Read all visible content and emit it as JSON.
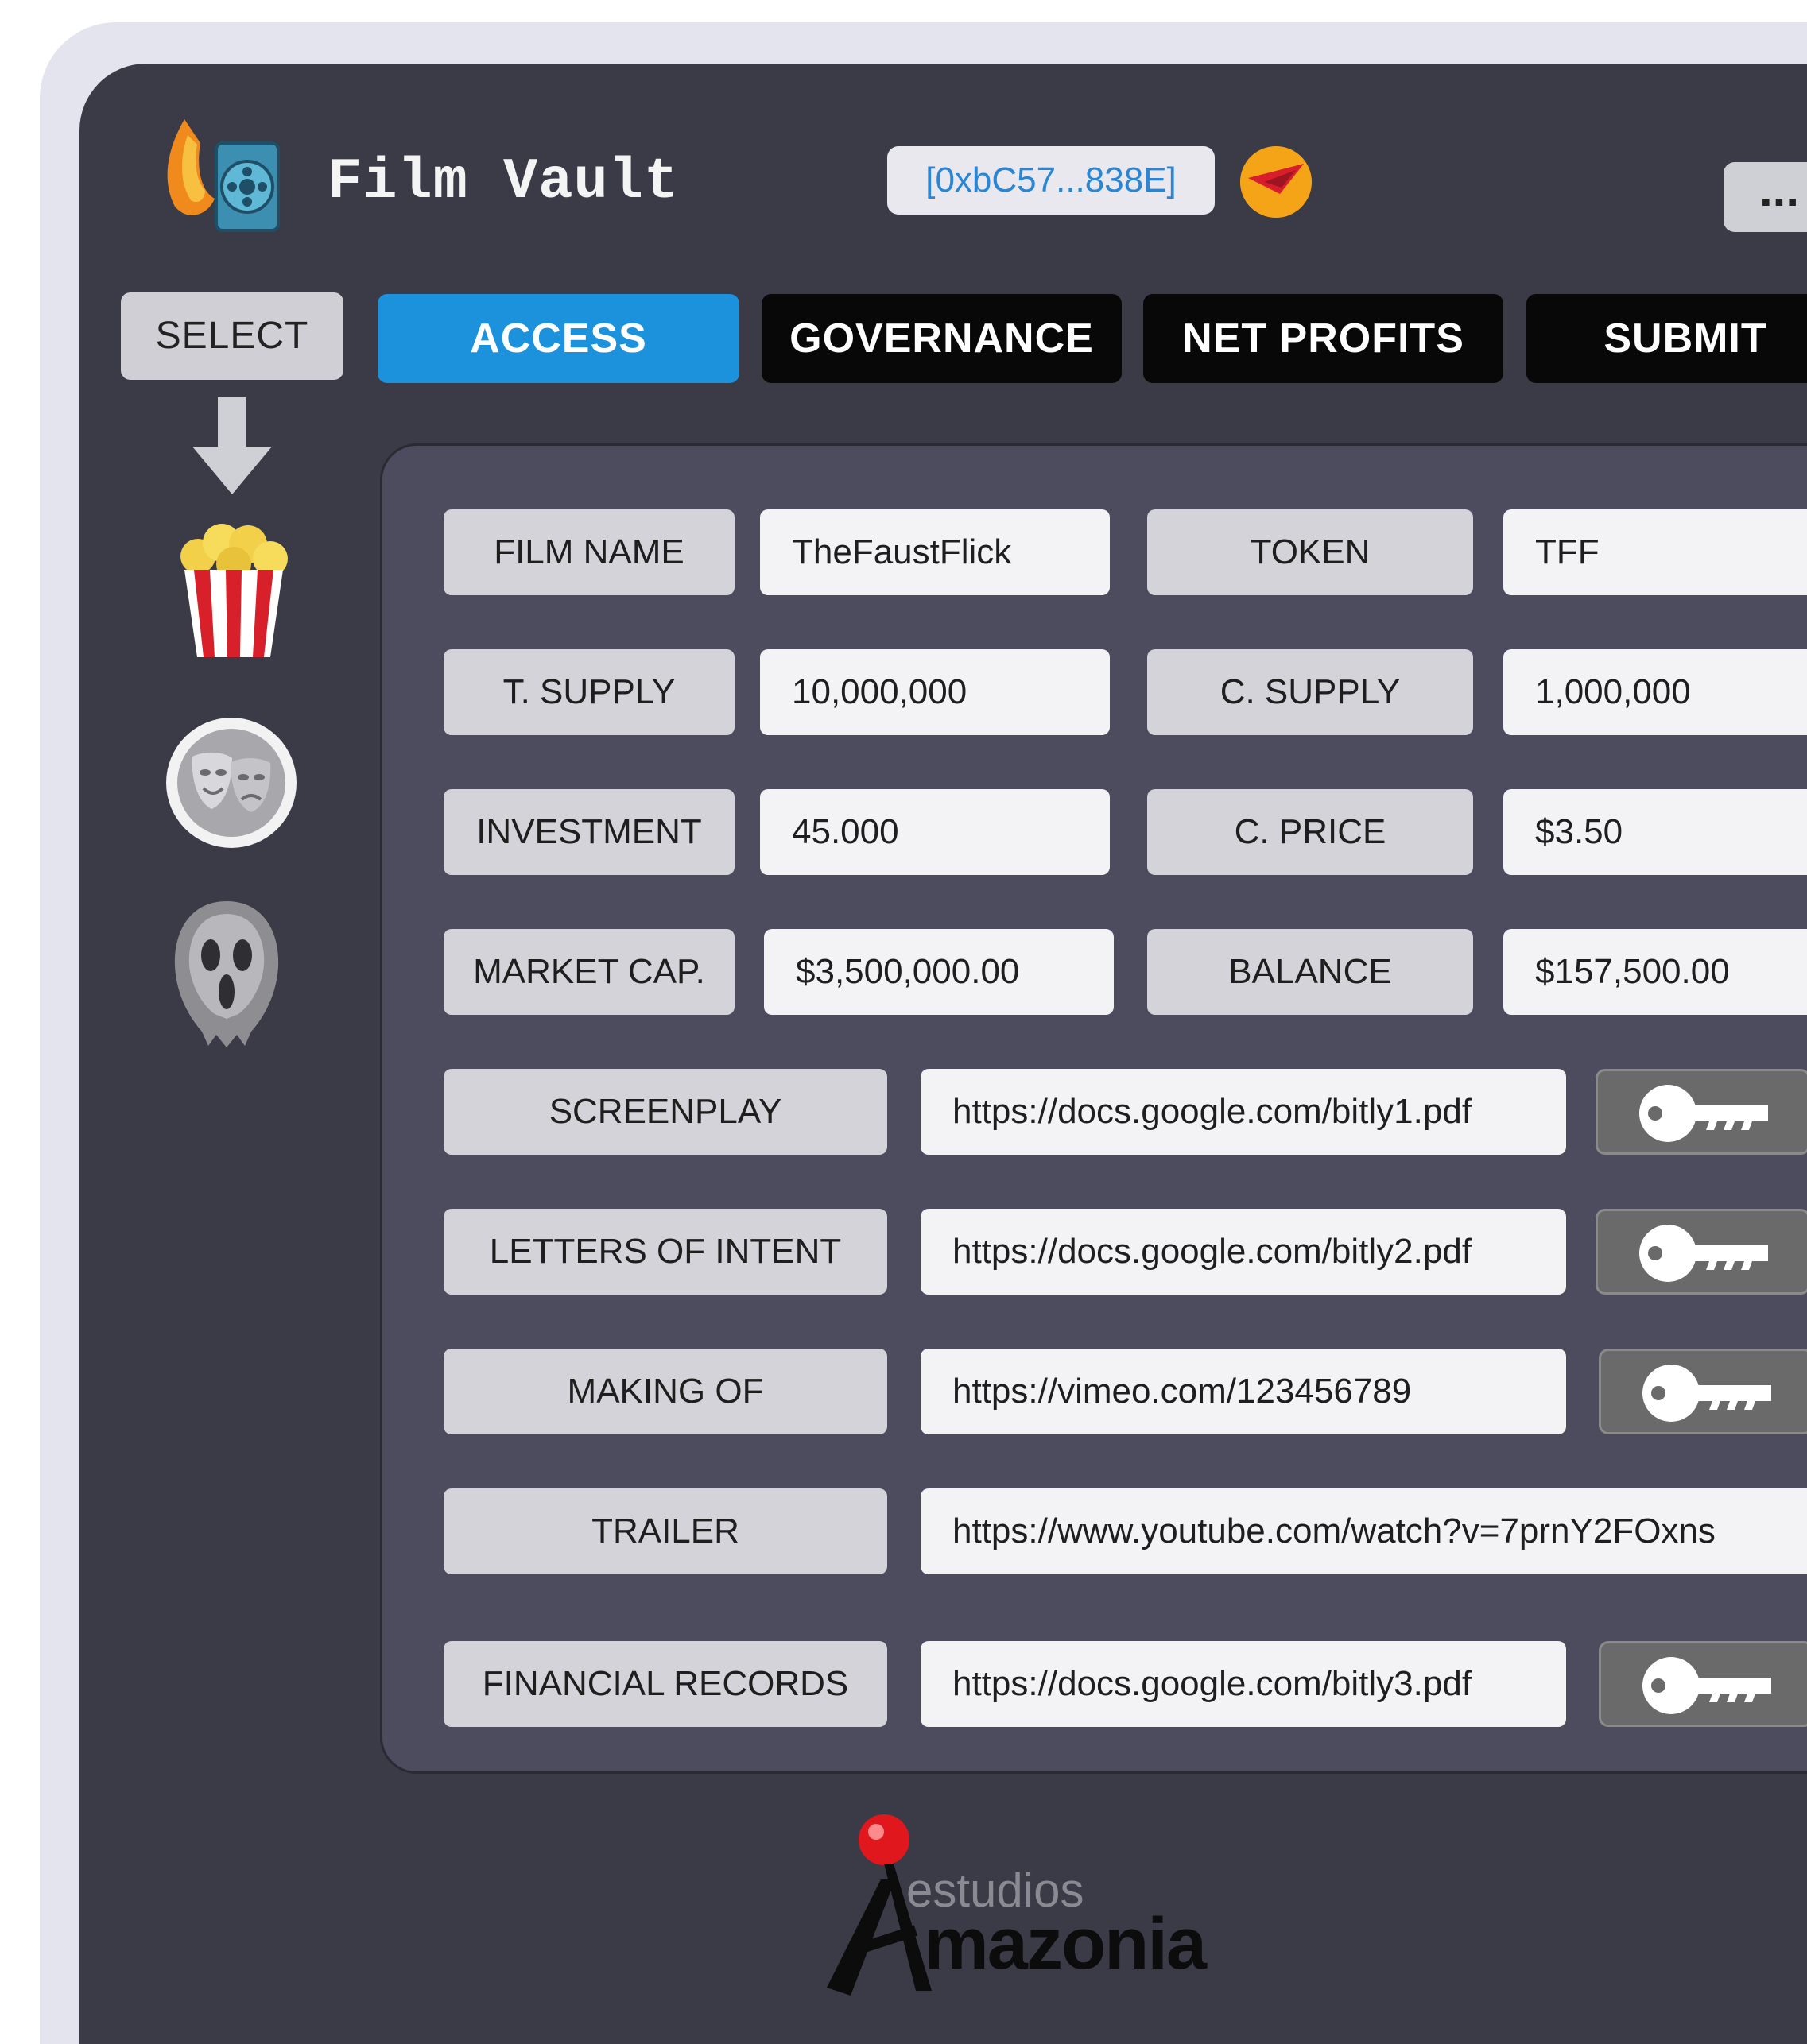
{
  "header": {
    "app_title": "Film Vault",
    "wallet_address": "[0xbC57...838E]",
    "more_label": "..."
  },
  "sidebar": {
    "select_label": "SELECT",
    "items": [
      {
        "icon": "popcorn-icon"
      },
      {
        "icon": "theater-masks-icon"
      },
      {
        "icon": "ghostface-mask-icon"
      }
    ]
  },
  "tabs": [
    {
      "label": "ACCESS",
      "active": true
    },
    {
      "label": "GOVERNANCE",
      "active": false
    },
    {
      "label": "NET PROFITS",
      "active": false
    },
    {
      "label": "SUBMIT",
      "active": false
    }
  ],
  "film_info": {
    "film_name": {
      "label": "FILM NAME",
      "value": "TheFaustFlick"
    },
    "token": {
      "label": "TOKEN",
      "value": "TFF"
    },
    "total_supply": {
      "label": "T. SUPPLY",
      "value": "10,000,000"
    },
    "circulating_supply": {
      "label": "C. SUPPLY",
      "value": "1,000,000"
    },
    "investment": {
      "label": "INVESTMENT",
      "value": "45.000"
    },
    "current_price": {
      "label": "C. PRICE",
      "value": "$3.50"
    },
    "market_cap": {
      "label": "MARKET CAP.",
      "value": "$3,500,000.00"
    },
    "balance": {
      "label": "BALANCE",
      "value": "$157,500.00"
    }
  },
  "documents": [
    {
      "label": "SCREENPLAY",
      "url": "https://docs.google.com/bitly1.pdf",
      "locked": true
    },
    {
      "label": "LETTERS OF INTENT",
      "url": "https://docs.google.com/bitly2.pdf",
      "locked": true
    },
    {
      "label": "MAKING OF",
      "url": "https://vimeo.com/123456789",
      "locked": true
    },
    {
      "label": "TRAILER",
      "url": "https://www.youtube.com/watch?v=7prnY2FOxns",
      "locked": false
    },
    {
      "label": "FINANCIAL RECORDS",
      "url": "https://docs.google.com/bitly3.pdf",
      "locked": true
    }
  ],
  "footer": {
    "brand_top": "estudios",
    "brand_bottom": "mazonia"
  },
  "colors": {
    "accent": "#1b92db",
    "panel": "#3b3a47",
    "card": "#4d4c5f",
    "tab_inactive": "#080808"
  }
}
